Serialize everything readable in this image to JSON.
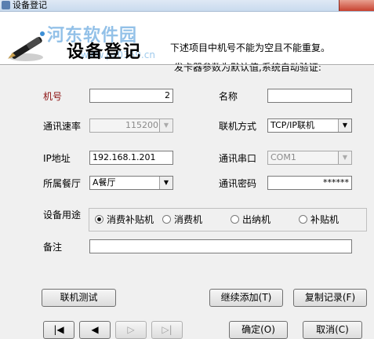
{
  "window": {
    "title": "设备登记"
  },
  "header": {
    "title": "设备登记",
    "watermark_name": "河东软件园",
    "watermark_url": "www.pc0359.cn",
    "note1": "下述项目中机号不能为空且不能重复。",
    "note2": "发卡器参数为默认值,系统自动验证:"
  },
  "form": {
    "machine_no": {
      "label": "机号",
      "value": "2"
    },
    "name": {
      "label": "名称",
      "value": ""
    },
    "baud_rate": {
      "label": "通讯速率",
      "value": "115200"
    },
    "connection_mode": {
      "label": "联机方式",
      "value": "TCP/IP联机"
    },
    "ip_address": {
      "label": "IP地址",
      "value": "192.168.1.201"
    },
    "serial_port": {
      "label": "通讯串口",
      "value": "COM1"
    },
    "restaurant": {
      "label": "所属餐厅",
      "value": "A餐厅"
    },
    "comm_password": {
      "label": "通讯密码",
      "value": "******"
    },
    "device_usage": {
      "label": "设备用途",
      "options": [
        "消费补贴机",
        "消费机",
        "出纳机",
        "补贴机"
      ],
      "selected": "消费补贴机"
    },
    "remarks": {
      "label": "备注",
      "value": ""
    }
  },
  "buttons": {
    "test_connection": "联机测试",
    "continue_add": "继续添加(T)",
    "copy_record": "复制记录(F)",
    "confirm": "确定(O)",
    "cancel": "取消(C)"
  },
  "nav": {
    "first": "|◀",
    "prev": "◀",
    "next": "▷",
    "last": "▷|"
  },
  "icons": {
    "dropdown": "chevron-down-icon",
    "header": "pen-icon"
  }
}
